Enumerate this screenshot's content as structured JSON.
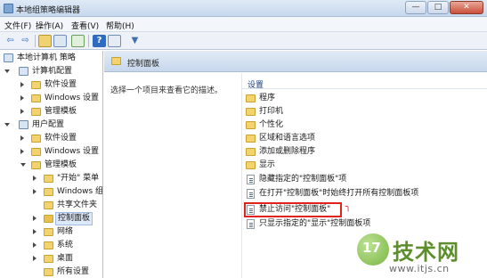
{
  "window": {
    "title": "本地组策略编辑器",
    "buttons": {
      "minimize": "—",
      "maximize": "□",
      "close": "✕"
    }
  },
  "menu": {
    "items": [
      "文件(F)",
      "操作(A)",
      "查看(V)",
      "帮助(H)"
    ]
  },
  "toolbar": {
    "icons": [
      "back-arrow-icon",
      "forward-arrow-icon",
      "up-folder-icon",
      "show-tree-icon",
      "export-list-icon",
      "help-icon",
      "properties-icon",
      "filter-icon"
    ]
  },
  "tree": {
    "root": "本地计算机 策略",
    "computer_config": "计算机配置",
    "computer_children": [
      "软件设置",
      "Windows 设置",
      "管理模板"
    ],
    "user_config": "用户配置",
    "user_children": [
      "软件设置",
      "Windows 设置",
      "管理模板"
    ],
    "admin_children": [
      "\"开始\" 菜单",
      "Windows 组",
      "共享文件夹",
      "控制面板",
      "网络",
      "系统",
      "桌面",
      "所有设置"
    ]
  },
  "panel": {
    "title": "控制面板",
    "description": "选择一个项目来查看它的描述。"
  },
  "list": {
    "column_header": "设置",
    "folders": [
      "程序",
      "打印机",
      "个性化",
      "区域和语言选项",
      "添加或删除程序",
      "显示"
    ],
    "policies": [
      "隐藏指定的\"控制面板\"项",
      "在打开\"控制面板\"时始终打开所有控制面板项",
      "禁止访问\"控制面板\"",
      "只显示指定的\"显示\"控制面板项"
    ]
  },
  "watermark": {
    "logo_text": "17",
    "name": "技术网",
    "url": "www.itjs.cn"
  },
  "colors": {
    "highlight": "#e0231d",
    "folder": "#f3d36e",
    "header": "#1d3f7a"
  }
}
